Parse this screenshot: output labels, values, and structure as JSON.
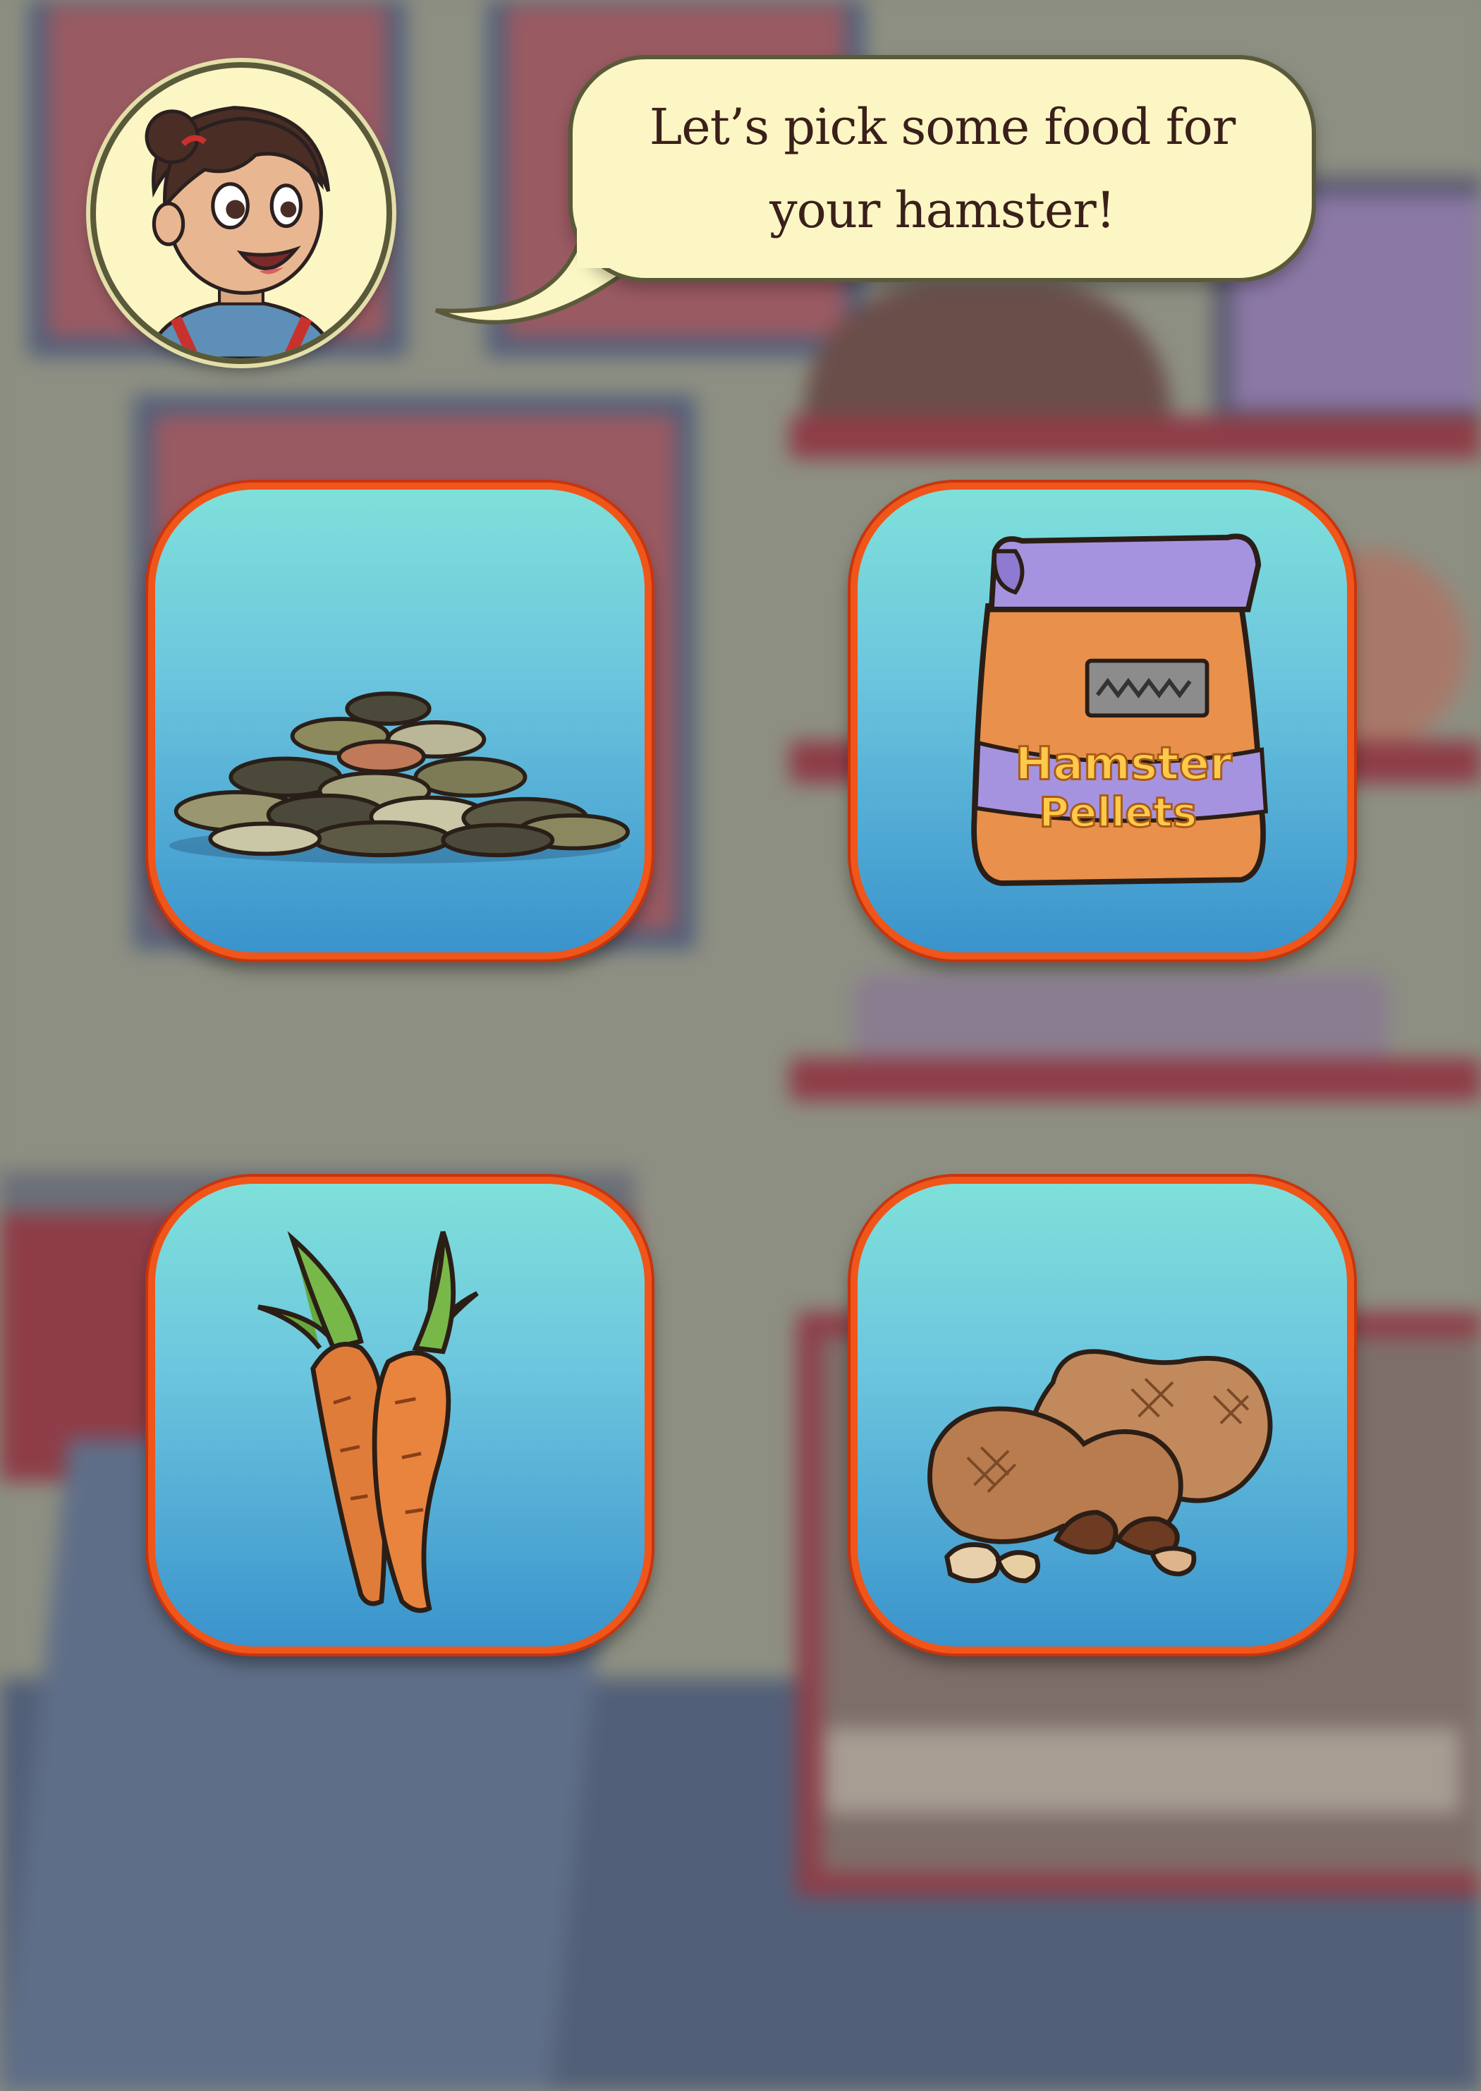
{
  "host": {
    "avatar_icon": "girl-host-avatar",
    "speech": "Let’s pick some food for your hamster!"
  },
  "choices": [
    {
      "id": "seeds",
      "icon": "seed-mix-icon"
    },
    {
      "id": "pellets",
      "icon": "hamster-pellets-bag-icon",
      "bag_label_line1": "Hamster",
      "bag_label_line2": "Pellets"
    },
    {
      "id": "carrots",
      "icon": "carrots-icon"
    },
    {
      "id": "peanuts",
      "icon": "peanuts-icon"
    }
  ],
  "colors": {
    "card_border": "#f0551a",
    "card_top": "#7fe0da",
    "card_bottom": "#3a93cc",
    "bubble_fill": "#fbf6c4",
    "text": "#3a1f1a"
  }
}
